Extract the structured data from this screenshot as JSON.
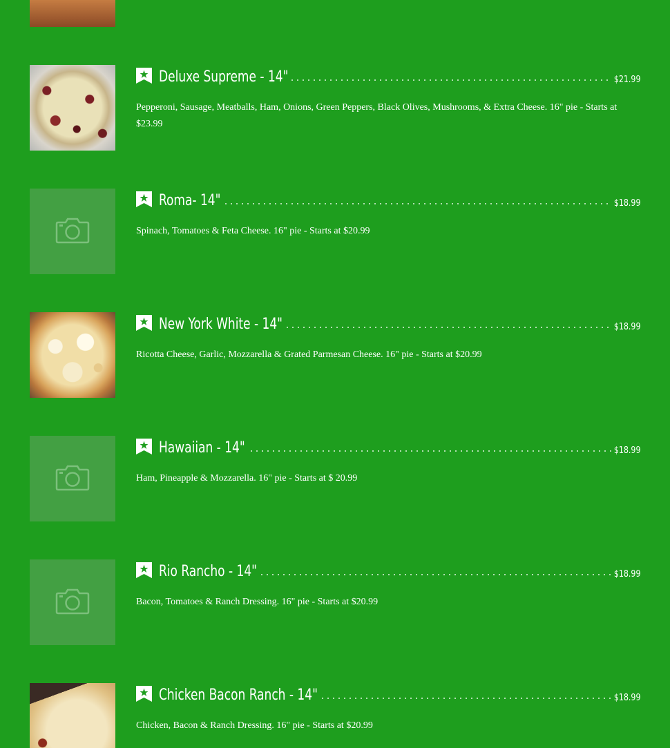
{
  "menu": {
    "items": [
      {
        "name": "Deluxe Supreme - 14\"",
        "price": "$21.99",
        "description": "Pepperoni, Sausage, Meatballs, Ham, Onions, Green Peppers, Black Olives, Mushrooms, & Extra Cheese. 16\" pie - Starts at $23.99",
        "image": "pizza-photo"
      },
      {
        "name": "Roma- 14\"",
        "price": "$18.99",
        "description": "Spinach, Tomatoes & Feta Cheese. 16\" pie - Starts at $20.99",
        "image": "camera-placeholder-icon"
      },
      {
        "name": "New York White - 14\"",
        "price": "$18.99",
        "description": "Ricotta Cheese, Garlic, Mozzarella & Grated Parmesan Cheese. 16\" pie - Starts at $20.99",
        "image": "pizza-photo"
      },
      {
        "name": "Hawaiian - 14\"",
        "price": "$18.99",
        "description": "Ham, Pineapple & Mozzarella. 16\" pie - Starts at $ 20.99",
        "image": "camera-placeholder-icon"
      },
      {
        "name": "Rio Rancho - 14\"",
        "price": "$18.99",
        "description": "Bacon, Tomatoes & Ranch Dressing. 16\" pie - Starts at $20.99",
        "image": "camera-placeholder-icon"
      },
      {
        "name": "Chicken Bacon Ranch - 14\"",
        "price": "$18.99",
        "description": "Chicken, Bacon & Ranch Dressing. 16\" pie - Starts at $20.99",
        "image": "pizza-photo"
      }
    ]
  },
  "colors": {
    "background": "#1e9e1e",
    "placeholder": "#43a043",
    "text": "#ffffff"
  },
  "icons": {
    "badge": "star-bookmark-icon",
    "placeholder": "camera-icon"
  }
}
